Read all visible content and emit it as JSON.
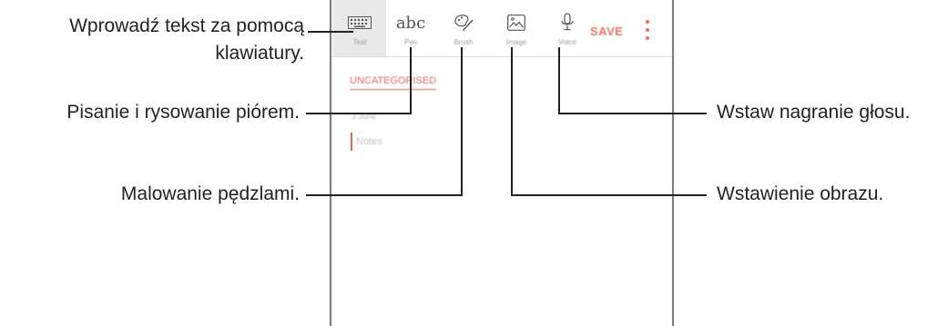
{
  "toolbar": {
    "tools": [
      {
        "id": "text",
        "label": "Text",
        "icon": "keyboard-icon"
      },
      {
        "id": "pen",
        "label": "Pen",
        "icon": "abc-handwriting-icon",
        "glyph": "abc"
      },
      {
        "id": "brush",
        "label": "Brush",
        "icon": "palette-brush-icon"
      },
      {
        "id": "image",
        "label": "Image",
        "icon": "image-icon"
      },
      {
        "id": "voice",
        "label": "Voice",
        "icon": "microphone-icon"
      }
    ],
    "save_label": "SAVE",
    "more_icon": "more-vertical-icon"
  },
  "note": {
    "category": "UNCATEGORISED",
    "date": "3 June",
    "placeholder": "Notes"
  },
  "callouts": {
    "keyboard_line1": "Wprowadź tekst za pomocą",
    "keyboard_line2": "klawiatury.",
    "pen": "Pisanie i rysowanie piórem.",
    "brush": "Malowanie pędzlami.",
    "voice": "Wstaw nagranie głosu.",
    "image": "Wstawienie obrazu."
  },
  "colors": {
    "accent": "#e8705f",
    "text": "#231f20"
  }
}
